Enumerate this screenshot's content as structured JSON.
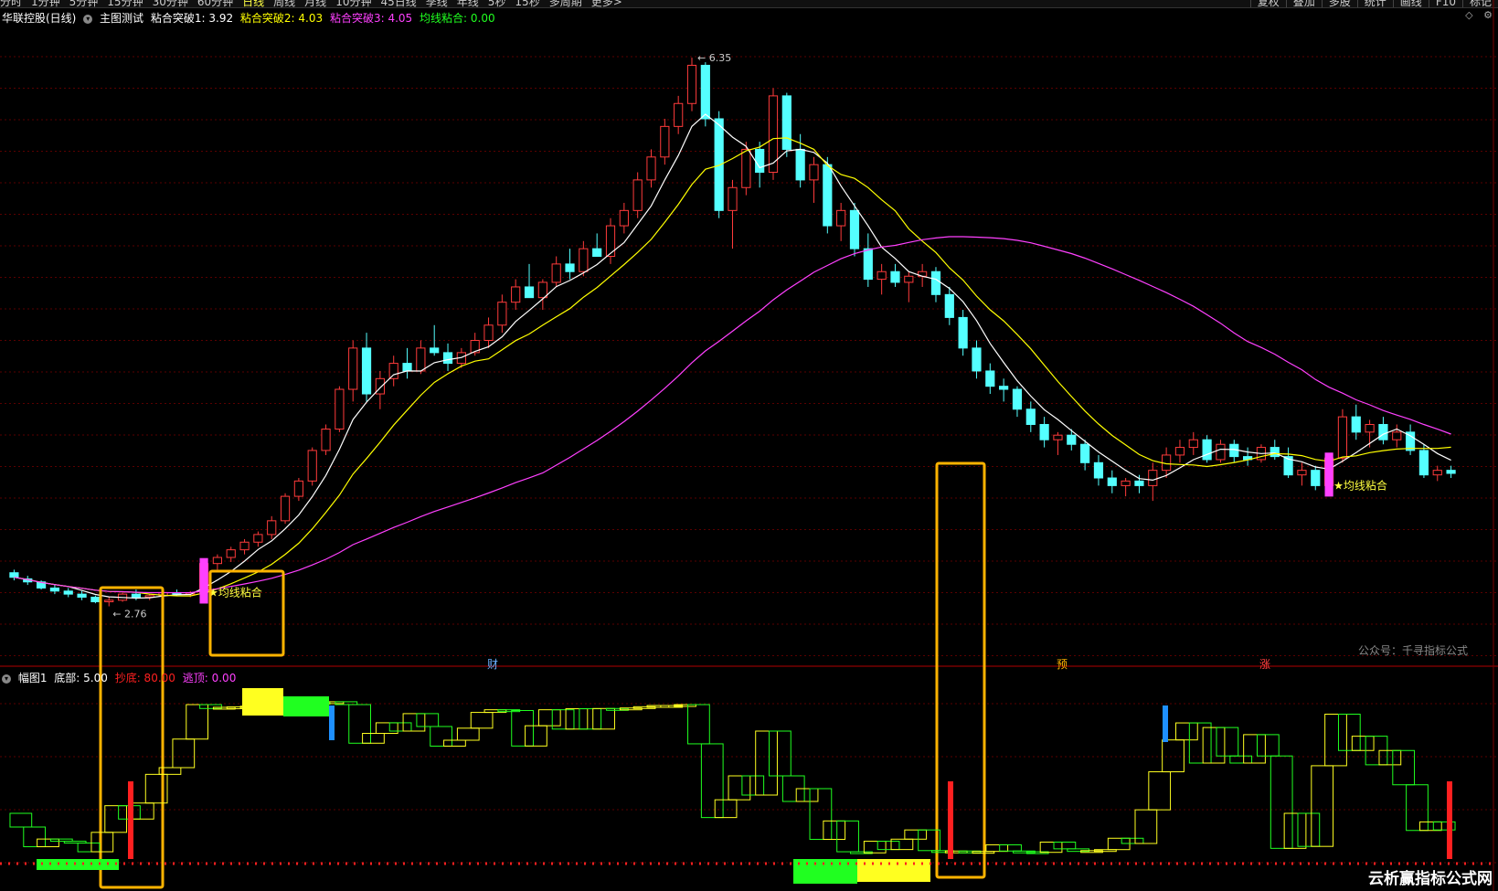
{
  "toolbar": {
    "periods": [
      "分时",
      "1分钟",
      "5分钟",
      "15分钟",
      "30分钟",
      "60分钟",
      "日线",
      "周线",
      "月线",
      "10分钟",
      "45日线",
      "季线",
      "年线",
      "5秒",
      "15秒",
      "多周期",
      "更多>"
    ],
    "active_index": 6,
    "right_buttons": [
      "复权",
      "叠加",
      "多股",
      "统计",
      "画线",
      "F10",
      "标记"
    ]
  },
  "info": {
    "stock": "华联控股(日线)",
    "indicator": "主图测试",
    "v1": "粘合突破1: 3.92",
    "v2": "粘合突破2: 4.03",
    "v3": "粘合突破3: 4.05",
    "v4": "均线粘合: 0.00"
  },
  "sub_info": {
    "name": "幅图1",
    "v1": "底部: 5.00",
    "v2": "抄底: 80.00",
    "v3": "逃顶: 0.00"
  },
  "labels": {
    "high": "6.35",
    "low": "2.76",
    "signal1": "均线粘合",
    "signal2": "均线粘合",
    "mark_cai": "财",
    "mark_yu": "预",
    "mark_zhang": "涨",
    "watermark": "公众号：千寻指标公式",
    "brand": "云析赢指标公式网"
  },
  "colors": {
    "up": "#ff3b3b",
    "down": "#54ffff",
    "ma_short": "#ffffff",
    "ma_mid": "#ffff00",
    "ma_long": "#ff40ff",
    "highlight_box": "#ffb300",
    "sub_green": "#20ff20",
    "sub_yellow": "#ffff20",
    "signal_red": "#ff2020",
    "signal_blue": "#1e90ff"
  },
  "chart_data": {
    "type": "candlestick",
    "ylim": [
      2.5,
      6.5
    ],
    "price_high": 6.35,
    "price_low": 2.76,
    "ohlc": [
      [
        2.98,
        3.0,
        2.93,
        2.95
      ],
      [
        2.94,
        2.96,
        2.9,
        2.92
      ],
      [
        2.92,
        2.93,
        2.87,
        2.88
      ],
      [
        2.88,
        2.9,
        2.84,
        2.86
      ],
      [
        2.86,
        2.88,
        2.82,
        2.84
      ],
      [
        2.84,
        2.86,
        2.8,
        2.82
      ],
      [
        2.82,
        2.83,
        2.78,
        2.79
      ],
      [
        2.79,
        2.82,
        2.76,
        2.8
      ],
      [
        2.8,
        2.85,
        2.79,
        2.84
      ],
      [
        2.84,
        2.87,
        2.8,
        2.82
      ],
      [
        2.82,
        2.84,
        2.8,
        2.83
      ],
      [
        2.83,
        2.86,
        2.81,
        2.85
      ],
      [
        2.85,
        2.87,
        2.83,
        2.84
      ],
      [
        2.84,
        2.86,
        2.82,
        2.85
      ],
      [
        2.85,
        3.05,
        2.84,
        3.04
      ],
      [
        3.04,
        3.1,
        3.0,
        3.08
      ],
      [
        3.08,
        3.15,
        3.05,
        3.13
      ],
      [
        3.13,
        3.2,
        3.1,
        3.18
      ],
      [
        3.18,
        3.25,
        3.15,
        3.23
      ],
      [
        3.23,
        3.35,
        3.2,
        3.32
      ],
      [
        3.32,
        3.5,
        3.3,
        3.48
      ],
      [
        3.48,
        3.6,
        3.45,
        3.58
      ],
      [
        3.58,
        3.8,
        3.55,
        3.78
      ],
      [
        3.78,
        3.95,
        3.75,
        3.92
      ],
      [
        3.92,
        4.2,
        3.9,
        4.18
      ],
      [
        4.18,
        4.5,
        4.1,
        4.45
      ],
      [
        4.45,
        4.55,
        4.1,
        4.15
      ],
      [
        4.15,
        4.3,
        4.05,
        4.25
      ],
      [
        4.25,
        4.4,
        4.2,
        4.35
      ],
      [
        4.35,
        4.45,
        4.25,
        4.3
      ],
      [
        4.3,
        4.5,
        4.28,
        4.45
      ],
      [
        4.45,
        4.6,
        4.4,
        4.42
      ],
      [
        4.42,
        4.48,
        4.3,
        4.35
      ],
      [
        4.35,
        4.45,
        4.32,
        4.42
      ],
      [
        4.42,
        4.55,
        4.4,
        4.5
      ],
      [
        4.5,
        4.65,
        4.45,
        4.6
      ],
      [
        4.6,
        4.8,
        4.55,
        4.75
      ],
      [
        4.75,
        4.9,
        4.7,
        4.85
      ],
      [
        4.85,
        5.0,
        4.8,
        4.78
      ],
      [
        4.78,
        4.9,
        4.7,
        4.88
      ],
      [
        4.88,
        5.05,
        4.85,
        5.0
      ],
      [
        5.0,
        5.1,
        4.9,
        4.95
      ],
      [
        4.95,
        5.15,
        4.92,
        5.1
      ],
      [
        5.1,
        5.2,
        5.05,
        5.05
      ],
      [
        5.05,
        5.3,
        5.0,
        5.25
      ],
      [
        5.25,
        5.4,
        5.2,
        5.35
      ],
      [
        5.35,
        5.6,
        5.3,
        5.55
      ],
      [
        5.55,
        5.75,
        5.5,
        5.7
      ],
      [
        5.7,
        5.95,
        5.65,
        5.9
      ],
      [
        5.9,
        6.1,
        5.85,
        6.05
      ],
      [
        6.05,
        6.35,
        6.0,
        6.3
      ],
      [
        6.3,
        6.32,
        5.9,
        5.95
      ],
      [
        5.95,
        6.0,
        5.3,
        5.35
      ],
      [
        5.35,
        5.55,
        5.1,
        5.5
      ],
      [
        5.5,
        5.8,
        5.45,
        5.75
      ],
      [
        5.75,
        5.8,
        5.5,
        5.6
      ],
      [
        5.6,
        6.15,
        5.55,
        6.1
      ],
      [
        6.1,
        6.12,
        5.7,
        5.75
      ],
      [
        5.75,
        5.85,
        5.5,
        5.55
      ],
      [
        5.55,
        5.7,
        5.4,
        5.65
      ],
      [
        5.65,
        5.7,
        5.2,
        5.25
      ],
      [
        5.25,
        5.4,
        5.15,
        5.35
      ],
      [
        5.35,
        5.4,
        5.05,
        5.1
      ],
      [
        5.1,
        5.2,
        4.85,
        4.9
      ],
      [
        4.9,
        5.0,
        4.8,
        4.95
      ],
      [
        4.95,
        5.0,
        4.85,
        4.88
      ],
      [
        4.88,
        4.95,
        4.75,
        4.92
      ],
      [
        4.92,
        5.0,
        4.85,
        4.95
      ],
      [
        4.95,
        4.98,
        4.75,
        4.8
      ],
      [
        4.8,
        4.85,
        4.6,
        4.65
      ],
      [
        4.65,
        4.7,
        4.4,
        4.45
      ],
      [
        4.45,
        4.5,
        4.25,
        4.3
      ],
      [
        4.3,
        4.35,
        4.15,
        4.2
      ],
      [
        4.2,
        4.25,
        4.1,
        4.18
      ],
      [
        4.18,
        4.2,
        4.0,
        4.05
      ],
      [
        4.05,
        4.1,
        3.9,
        3.95
      ],
      [
        3.95,
        4.0,
        3.8,
        3.85
      ],
      [
        3.85,
        3.9,
        3.75,
        3.88
      ],
      [
        3.88,
        3.92,
        3.78,
        3.82
      ],
      [
        3.82,
        3.85,
        3.65,
        3.7
      ],
      [
        3.7,
        3.75,
        3.55,
        3.6
      ],
      [
        3.6,
        3.65,
        3.5,
        3.55
      ],
      [
        3.55,
        3.6,
        3.48,
        3.58
      ],
      [
        3.58,
        3.62,
        3.5,
        3.55
      ],
      [
        3.55,
        3.7,
        3.45,
        3.65
      ],
      [
        3.65,
        3.8,
        3.6,
        3.75
      ],
      [
        3.75,
        3.85,
        3.7,
        3.8
      ],
      [
        3.8,
        3.9,
        3.75,
        3.85
      ],
      [
        3.85,
        3.88,
        3.7,
        3.72
      ],
      [
        3.72,
        3.85,
        3.7,
        3.82
      ],
      [
        3.82,
        3.85,
        3.7,
        3.74
      ],
      [
        3.74,
        3.8,
        3.68,
        3.72
      ],
      [
        3.72,
        3.82,
        3.7,
        3.8
      ],
      [
        3.8,
        3.85,
        3.72,
        3.74
      ],
      [
        3.74,
        3.8,
        3.6,
        3.62
      ],
      [
        3.62,
        3.7,
        3.55,
        3.65
      ],
      [
        3.65,
        3.68,
        3.52,
        3.55
      ],
      [
        3.55,
        3.75,
        3.53,
        3.73
      ],
      [
        3.73,
        4.05,
        3.7,
        4.0
      ],
      [
        4.0,
        4.08,
        3.85,
        3.9
      ],
      [
        3.9,
        3.98,
        3.8,
        3.95
      ],
      [
        3.95,
        4.0,
        3.82,
        3.85
      ],
      [
        3.85,
        3.95,
        3.8,
        3.9
      ],
      [
        3.9,
        3.95,
        3.75,
        3.78
      ],
      [
        3.78,
        3.82,
        3.6,
        3.62
      ],
      [
        3.62,
        3.68,
        3.58,
        3.65
      ],
      [
        3.65,
        3.68,
        3.6,
        3.63
      ]
    ]
  }
}
